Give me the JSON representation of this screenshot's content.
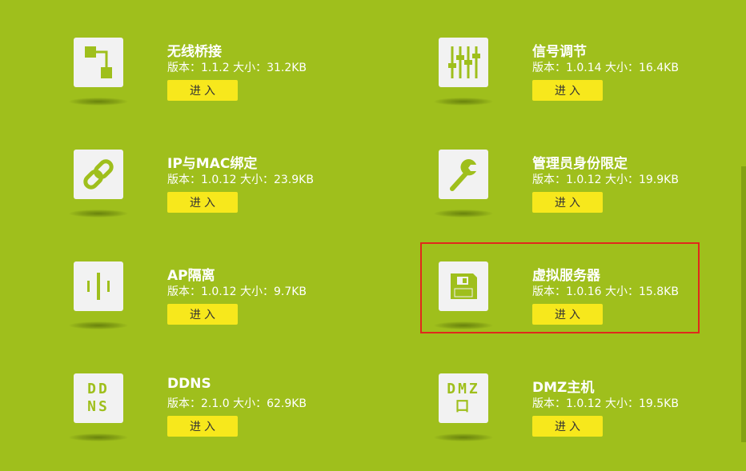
{
  "colors": {
    "background": "#9fbf1c",
    "tile": "#f2f2f2",
    "button": "#f7e81c",
    "highlight": "#e0291c"
  },
  "apps": [
    {
      "name": "无线桥接",
      "meta": "版本：1.1.2 大小：31.2KB",
      "button": "进入",
      "icon": "bridge-icon"
    },
    {
      "name": "信号调节",
      "meta": "版本：1.0.14 大小：16.4KB",
      "button": "进入",
      "icon": "sliders-icon"
    },
    {
      "name": "IP与MAC绑定",
      "meta": "版本：1.0.12 大小：23.9KB",
      "button": "进入",
      "icon": "link-icon"
    },
    {
      "name": "管理员身份限定",
      "meta": "版本：1.0.12 大小：19.9KB",
      "button": "进入",
      "icon": "wrench-icon"
    },
    {
      "name": "AP隔离",
      "meta": "版本：1.0.12 大小：9.7KB",
      "button": "进入",
      "icon": "isolation-icon"
    },
    {
      "name": "虚拟服务器",
      "meta": "版本：1.0.16 大小：15.8KB",
      "button": "进入",
      "icon": "floppy-disk-icon"
    },
    {
      "name": "DDNS",
      "meta": "版本：2.1.0 大小：62.9KB",
      "button": "进入",
      "icon": "ddns-icon",
      "icon_text": [
        "DD",
        "NS"
      ]
    },
    {
      "name": "DMZ主机",
      "meta": "版本：1.0.12 大小：19.5KB",
      "button": "进入",
      "icon": "dmz-icon",
      "icon_text": [
        "DMZ",
        "口"
      ]
    }
  ]
}
